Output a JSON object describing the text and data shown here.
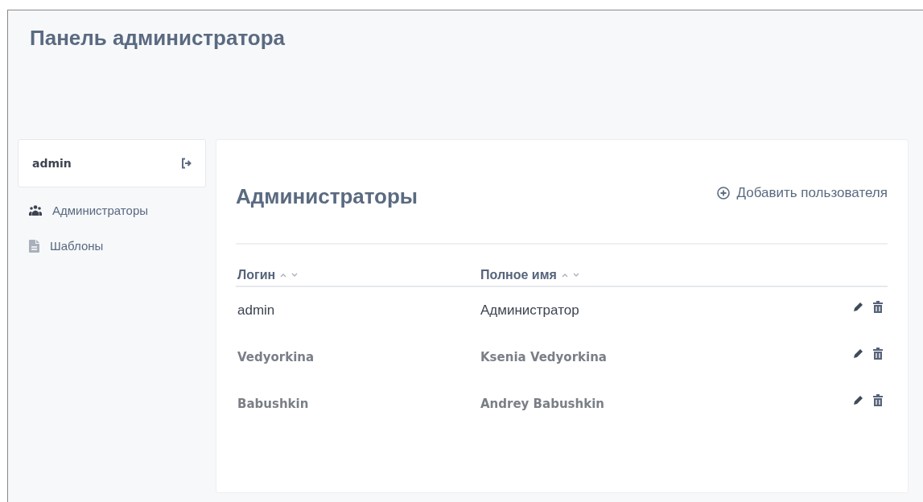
{
  "header": {
    "title": "Панель администратора"
  },
  "sidebar": {
    "user": {
      "name": "admin"
    },
    "items": [
      {
        "label": "Администраторы",
        "kind": "group",
        "selected": false
      },
      {
        "label": "Шаблоны",
        "kind": "document",
        "selected": false
      }
    ]
  },
  "main": {
    "title": "Администраторы",
    "add_button": "Добавить пользователя",
    "table": {
      "columns": [
        "Логин",
        "Полное имя"
      ],
      "rows": [
        {
          "kind": "plain",
          "cells": [
            "admin",
            "Администратор"
          ]
        },
        {
          "kind": "bold",
          "cells": [
            "Vedyorkina",
            "Ksenia Vedyorkina"
          ]
        },
        {
          "kind": "bold",
          "cells": [
            "Babushkin",
            "Andrey Babushkin"
          ]
        }
      ]
    }
  }
}
